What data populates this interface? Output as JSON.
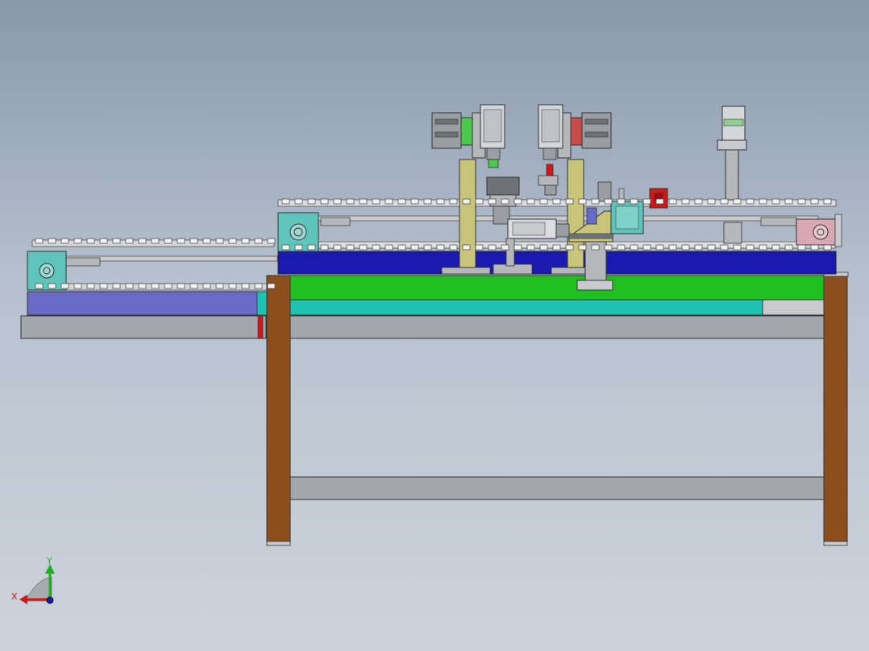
{
  "viewport": {
    "background_top": "#8898ad",
    "background_bottom": "#cdd3db"
  },
  "colors": {
    "frame_top_green": "#1fc01f",
    "plate_teal": "#1ec2b0",
    "conveyor_blue": "#1a1ab0",
    "conveyor_base_lavender": "#6a6ac8",
    "leg_brown": "#8b4e1c",
    "column_khaki": "#c8c47a",
    "frame_gray": "#a3a7ad",
    "indicator_red": "#d01818",
    "end_block_pink": "#d8a8b4",
    "drive_block_teal": "#5fc4bc"
  },
  "triad": {
    "x_label": "X",
    "y_label": "Y",
    "z_icon": "z-axis-dot-icon"
  }
}
